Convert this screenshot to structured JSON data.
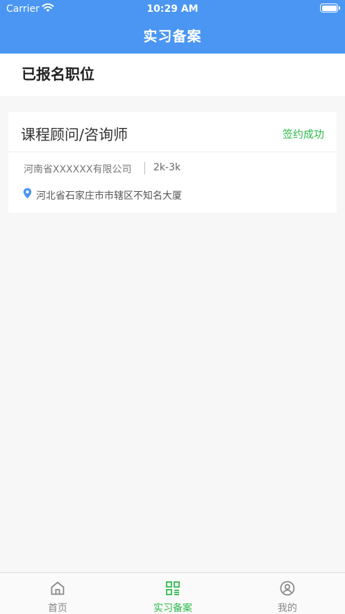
{
  "status_bar": {
    "carrier": "Carrier",
    "time": "10:29 AM"
  },
  "nav": {
    "title": "实习备案"
  },
  "section": {
    "title": "已报名职位"
  },
  "application": {
    "job_title": "课程顾问/咨询师",
    "status": "签约成功",
    "company": "河南省XXXXXX有限公司",
    "salary": "2k-3k",
    "address": "河北省石家庄市市辖区不知名大厦"
  },
  "tabbar": {
    "items": [
      {
        "label": "首页",
        "icon": "home-icon",
        "active": false
      },
      {
        "label": "实习备案",
        "icon": "qr-grid-icon",
        "active": true
      },
      {
        "label": "我的",
        "icon": "user-circle-icon",
        "active": false
      }
    ]
  },
  "colors": {
    "header": "#4a96f2",
    "accent_green": "#2cb94a",
    "background": "#f7f7f7"
  }
}
